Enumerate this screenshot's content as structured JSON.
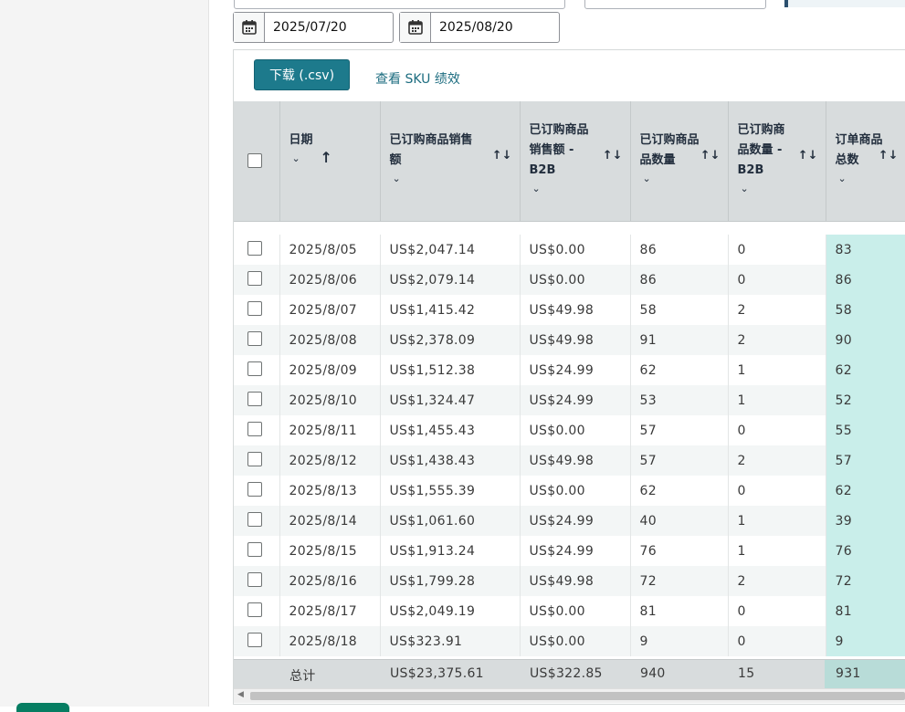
{
  "filters": {
    "start_date": "2025/07/20",
    "end_date": "2025/08/20"
  },
  "toolbar": {
    "download_label": "下载 (.csv)",
    "sku_link": "查看 SKU 绩效"
  },
  "table": {
    "headers": [
      {
        "line1": "日期",
        "line2": ""
      },
      {
        "line1": "已订购商品销售",
        "line2": "额"
      },
      {
        "line1": "已订购商品",
        "line2": "销售额 -",
        "line3": "B2B"
      },
      {
        "line1": "已订购商品",
        "line2": "品数量"
      },
      {
        "line1": "已订购商",
        "line2": "品数量 -",
        "line3": "B2B"
      },
      {
        "line1": "订单商品",
        "line2": "总数"
      }
    ],
    "rows": [
      [
        "2025/8/05",
        "US$2,047.14",
        "US$0.00",
        "86",
        "0",
        "83"
      ],
      [
        "2025/8/06",
        "US$2,079.14",
        "US$0.00",
        "86",
        "0",
        "86"
      ],
      [
        "2025/8/07",
        "US$1,415.42",
        "US$49.98",
        "58",
        "2",
        "58"
      ],
      [
        "2025/8/08",
        "US$2,378.09",
        "US$49.98",
        "91",
        "2",
        "90"
      ],
      [
        "2025/8/09",
        "US$1,512.38",
        "US$24.99",
        "62",
        "1",
        "62"
      ],
      [
        "2025/8/10",
        "US$1,324.47",
        "US$24.99",
        "53",
        "1",
        "52"
      ],
      [
        "2025/8/11",
        "US$1,455.43",
        "US$0.00",
        "57",
        "0",
        "55"
      ],
      [
        "2025/8/12",
        "US$1,438.43",
        "US$49.98",
        "57",
        "2",
        "57"
      ],
      [
        "2025/8/13",
        "US$1,555.39",
        "US$0.00",
        "62",
        "0",
        "62"
      ],
      [
        "2025/8/14",
        "US$1,061.60",
        "US$24.99",
        "40",
        "1",
        "39"
      ],
      [
        "2025/8/15",
        "US$1,913.24",
        "US$24.99",
        "76",
        "1",
        "76"
      ],
      [
        "2025/8/16",
        "US$1,799.28",
        "US$49.98",
        "72",
        "2",
        "72"
      ],
      [
        "2025/8/17",
        "US$2,049.19",
        "US$0.00",
        "81",
        "0",
        "81"
      ],
      [
        "2025/8/18",
        "US$323.91",
        "US$0.00",
        "9",
        "0",
        "9"
      ]
    ],
    "totals": {
      "label": "总计",
      "sales": "US$23,375.61",
      "sales_b2b": "US$322.85",
      "units": "940",
      "units_b2b": "15",
      "total_items": "931"
    }
  },
  "colors": {
    "primary_button": "#1d7a8c",
    "highlight_column": "#c9eeea",
    "header_bg": "#d8dcdd"
  },
  "icons": {
    "calendar": "calendar-icon",
    "sort": "sort-icon",
    "chevron": "chevron-down-icon"
  }
}
